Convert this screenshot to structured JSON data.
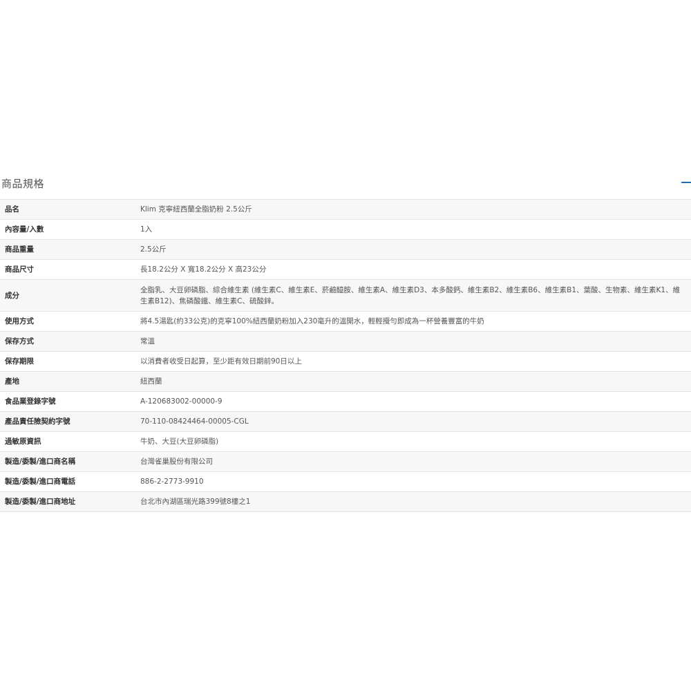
{
  "section": {
    "title": "商品規格",
    "collapse_icon": "minus-icon",
    "accent_color": "#1f6fb2"
  },
  "rows": [
    {
      "label": "品名",
      "value": "Klim 克寧紐西蘭全脂奶粉 2.5公斤"
    },
    {
      "label": "內容量/入數",
      "value": "1入"
    },
    {
      "label": "商品重量",
      "value": "2.5公斤"
    },
    {
      "label": "商品尺寸",
      "value": "長18.2公分 X 寬18.2公分 X 高23公分"
    },
    {
      "label": "成分",
      "value": "全脂乳、大豆卵磷脂、綜合維生素 (維生素C、維生素E、菸鹼醯胺、維生素A、維生素D3、本多酸鈣、維生素B2、維生素B6、維生素B1、葉酸、生物素、維生素K1、維生素B12)、焦磷酸鐵、維生素C、硫酸鋅。"
    },
    {
      "label": "使用方式",
      "value": "將4.5湯匙(約33公克)的克寧100%紐西蘭奶粉加入230毫升的溫開水，輕輕攪勻即成為一杯營養豐富的牛奶"
    },
    {
      "label": "保存方式",
      "value": "常溫"
    },
    {
      "label": "保存期限",
      "value": "以消費者收受日起算，至少距有效日期前90日以上"
    },
    {
      "label": "產地",
      "value": "紐西蘭"
    },
    {
      "label": "食品業登錄字號",
      "value": "A-120683002-00000-9"
    },
    {
      "label": "產品責任險契約字號",
      "value": "70-110-08424464-00005-CGL"
    },
    {
      "label": "過敏原資訊",
      "value": "牛奶、大豆(大豆卵磷脂)"
    },
    {
      "label": "製造/委製/進口商名稱",
      "value": "台灣雀巢股份有限公司"
    },
    {
      "label": "製造/委製/進口商電話",
      "value": "886-2-2773-9910"
    },
    {
      "label": "製造/委製/進口商地址",
      "value": "台北市內湖區瑞光路399號8樓之1"
    }
  ]
}
